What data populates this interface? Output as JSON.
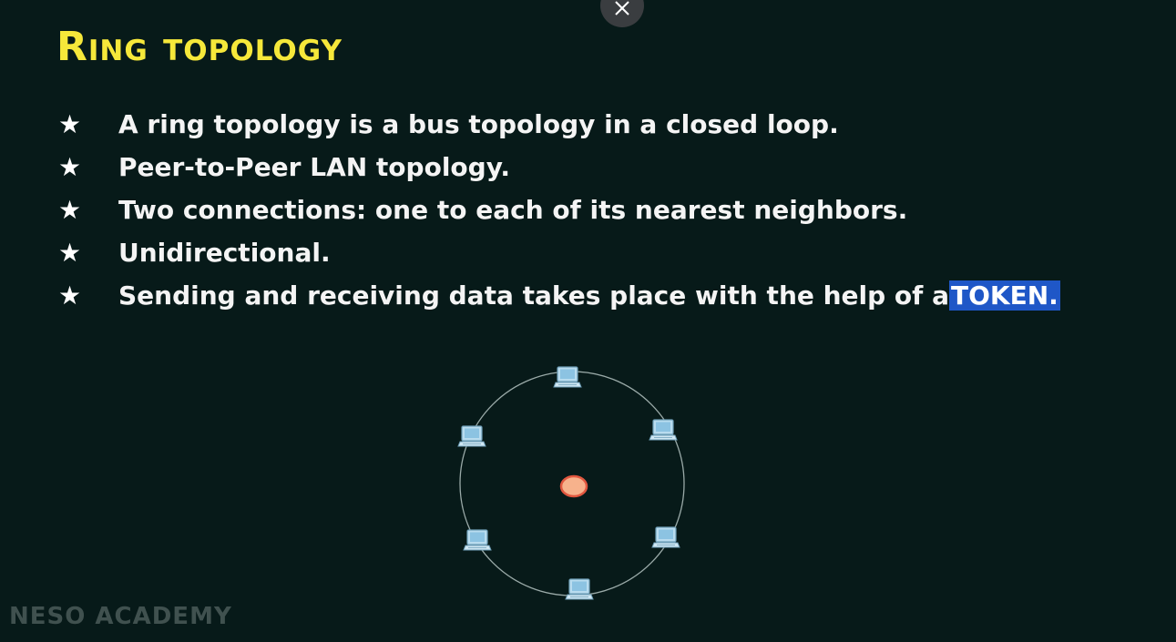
{
  "title": "Ring topology",
  "bullets": [
    {
      "icon": "star-icon",
      "text": "A ring topology is a bus topology in a closed loop."
    },
    {
      "icon": "star-icon",
      "text": "Peer-to-Peer LAN topology."
    },
    {
      "icon": "star-icon",
      "text": "Two connections: one to each of its nearest neighbors."
    },
    {
      "icon": "star-icon",
      "text": "Unidirectional."
    },
    {
      "icon": "star-icon",
      "text": "Sending and receiving data takes place with the help of a ",
      "highlight": "TOKEN."
    }
  ],
  "diagram": {
    "node_icon": "computer-icon",
    "token_icon": "token-icon",
    "node_count": 6,
    "colors": {
      "ring": "#9aaaa8",
      "node": "#b9dcef",
      "token_fill": "#f7b28c",
      "token_stroke": "#e1573f"
    }
  },
  "watermark": "NESO ACADEMY",
  "colors": {
    "background": "#071a19",
    "title": "#f6e83a",
    "highlight": "#1f57c7"
  },
  "controls": {
    "close_icon": "close-icon"
  }
}
